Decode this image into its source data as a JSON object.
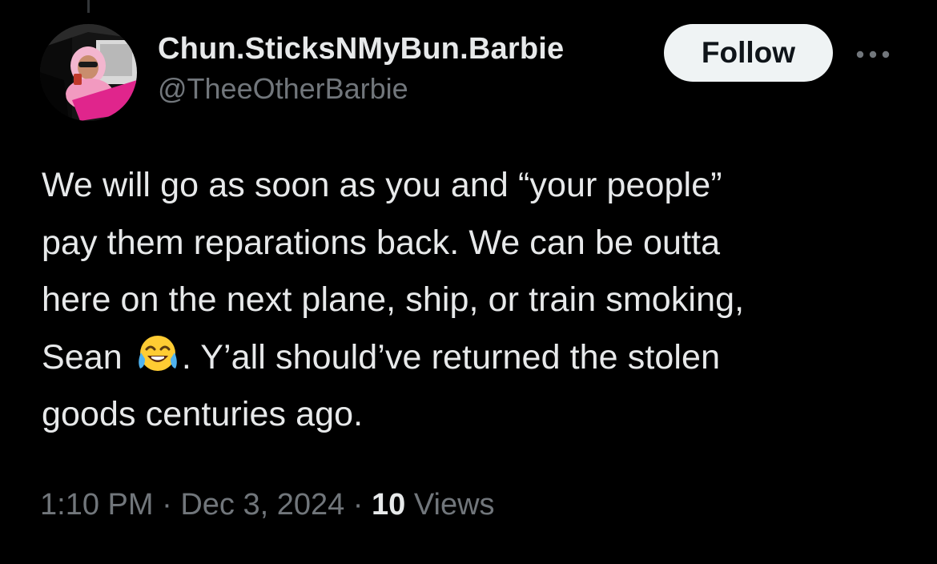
{
  "author": {
    "display_name": "Chun.SticksNMyBun.Barbie",
    "handle": "@TheeOtherBarbie"
  },
  "follow_label": "Follow",
  "tweet": {
    "line1": "We will go as soon as you and “your people”",
    "line2": "pay them reparations back. We can be outta",
    "line3": "here on the next plane, ship, or train smoking,",
    "line4_before_emoji": "Sean ",
    "line4_after_emoji": ". Y’all should’ve returned the stolen",
    "line5": "goods centuries ago.",
    "emoji": "face-with-tears-of-joy"
  },
  "meta": {
    "time": "1:10 PM",
    "separator": " · ",
    "date": "Dec 3, 2024",
    "views_count": "10",
    "views_label": " Views"
  },
  "colors": {
    "background": "#000000",
    "primary_text": "#e7e9ea",
    "secondary_text": "#71767b",
    "follow_bg": "#eff3f4"
  },
  "icons": {
    "more": "more-options-icon"
  }
}
